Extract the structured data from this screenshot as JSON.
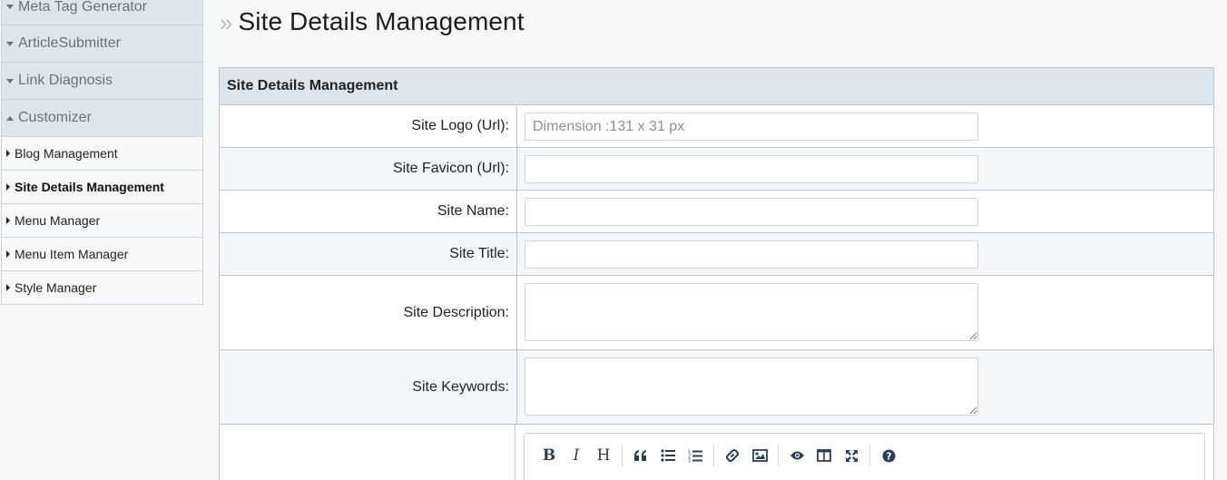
{
  "sidebar": {
    "sections": [
      {
        "label": "Meta Tag Generator"
      },
      {
        "label": "ArticleSubmitter"
      },
      {
        "label": "Link Diagnosis"
      },
      {
        "label": "Customizer"
      }
    ],
    "items": [
      {
        "label": "Blog Management"
      },
      {
        "label": "Site Details Management"
      },
      {
        "label": "Menu Manager"
      },
      {
        "label": "Menu Item Manager"
      },
      {
        "label": "Style Manager"
      }
    ]
  },
  "page": {
    "title": "Site Details Management"
  },
  "form": {
    "panel_title": "Site Details Management",
    "logo": {
      "label": "Site Logo (Url):",
      "value": "",
      "placeholder": "Dimension :131 x 31 px"
    },
    "favicon": {
      "label": "Site Favicon (Url):",
      "value": "",
      "placeholder": ""
    },
    "name": {
      "label": "Site Name:",
      "value": "",
      "placeholder": ""
    },
    "title": {
      "label": "Site Title:",
      "value": "",
      "placeholder": ""
    },
    "description": {
      "label": "Site Description:",
      "value": ""
    },
    "keywords": {
      "label": "Site Keywords:",
      "value": ""
    }
  },
  "editor_toolbar": {
    "bold": "B",
    "italic": "I",
    "heading": "H",
    "icons": [
      "bold-icon",
      "italic-icon",
      "heading-icon",
      "quote-icon",
      "unordered-list-icon",
      "ordered-list-icon",
      "link-icon",
      "image-icon",
      "preview-icon",
      "side-by-side-icon",
      "fullscreen-icon",
      "help-icon"
    ]
  }
}
